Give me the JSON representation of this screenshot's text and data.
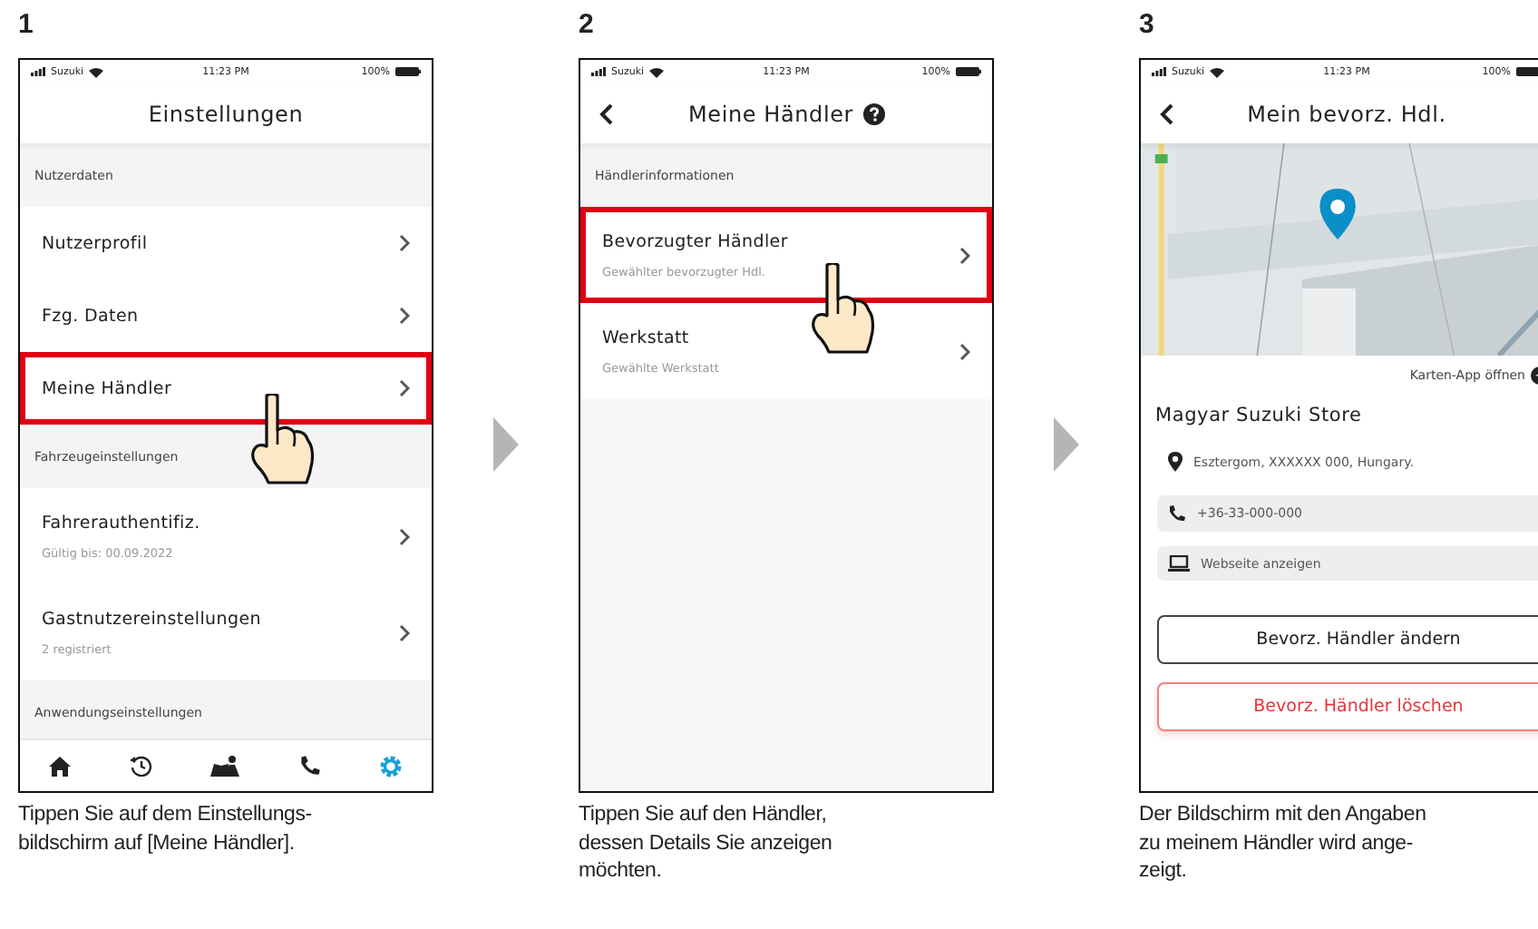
{
  "steps": [
    {
      "number": "1",
      "screen": {
        "status": {
          "carrier": "Suzuki",
          "time": "11:23 PM",
          "battery": "100%"
        },
        "title": "Einstellungen",
        "back": false,
        "help": false,
        "rows": [
          {
            "kind": "section",
            "label": "Nutzerdaten"
          },
          {
            "kind": "item",
            "label": "Nutzerprofil",
            "highlighted": false
          },
          {
            "kind": "item",
            "label": "Fzg. Daten",
            "highlighted": false
          },
          {
            "kind": "item",
            "label": "Meine Händler",
            "highlighted": true
          },
          {
            "kind": "section",
            "label": "Fahrzeugeinstellungen"
          },
          {
            "kind": "item",
            "label": "Fahrerauthentifiz.",
            "sub": "Gültig bis: 00.09.2022",
            "highlighted": false
          },
          {
            "kind": "item",
            "label": "Gastnutzereinstellungen",
            "sub": "2 registriert",
            "highlighted": false
          },
          {
            "kind": "section",
            "label": "Anwendungseinstellungen"
          }
        ],
        "tabs": [
          {
            "selected": false
          },
          {
            "selected": false
          },
          {
            "selected": false
          },
          {
            "selected": false
          },
          {
            "selected": true
          }
        ]
      },
      "caption": "Tippen Sie auf dem Einstellungs-\nbildschirm auf [Meine Händler]."
    },
    {
      "number": "2",
      "screen": {
        "status": {
          "carrier": "Suzuki",
          "time": "11:23 PM",
          "battery": "100%"
        },
        "title": "Meine Händler",
        "back": true,
        "help": true,
        "rows": [
          {
            "kind": "section",
            "label": "Händlerinformationen"
          },
          {
            "kind": "item",
            "label": "Bevorzugter Händler",
            "sub": "Gewählter bevorzugter Hdl.",
            "highlighted": true
          },
          {
            "kind": "item",
            "label": "Werkstatt",
            "sub": "Gewählte Werkstatt",
            "highlighted": false
          }
        ]
      },
      "caption": "Tippen Sie auf den Händler,\ndessen Details Sie anzeigen\nmöchten."
    },
    {
      "number": "3",
      "screen": {
        "status": {
          "carrier": "Suzuki",
          "time": "11:23 PM",
          "battery": "100%"
        },
        "title": "Mein bevorz. Hdl.",
        "back": true,
        "help": false,
        "rows": [
          {
            "kind": "map"
          },
          {
            "kind": "link",
            "label": "Karten-App öffnen"
          },
          {
            "kind": "heading",
            "label": "Magyar Suzuki Store"
          },
          {
            "kind": "address",
            "label": "Esztergom, XXXXXX 000, Hungary."
          },
          {
            "kind": "phone",
            "label": "+36-33-000-000"
          },
          {
            "kind": "website",
            "label": "Webseite anzeigen"
          },
          {
            "kind": "outline-button",
            "label": "Bevorz. Händler ändern"
          },
          {
            "kind": "danger-button",
            "label": "Bevorz. Händler löschen"
          }
        ]
      },
      "caption": "Der Bildschirm mit den Angaben\nzu meinem Händler wird ange-\nzeigt."
    }
  ]
}
